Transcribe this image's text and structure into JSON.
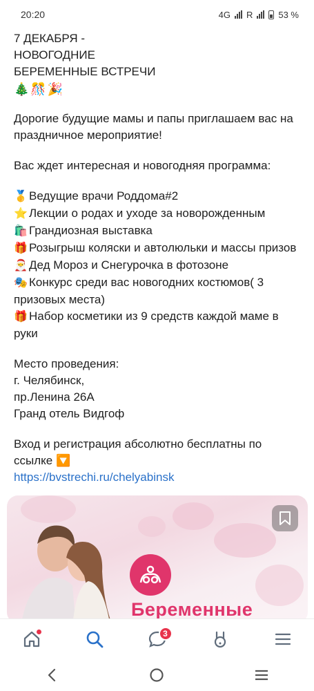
{
  "status_bar": {
    "time": "20:20",
    "network": "4G",
    "roaming": "R",
    "battery": "53 %"
  },
  "post": {
    "title_line1": "7 ДЕКАБРЯ -",
    "title_line2": "НОВОГОДНИЕ",
    "title_line3": "БЕРЕМЕННЫЕ ВСТРЕЧИ",
    "title_emojis": "🎄🎊🎉",
    "intro": "Дорогие будущие мамы и папы приглашаем вас на праздничное мероприятие!",
    "program_intro": "Вас ждет интересная и новогодняя программа:",
    "list": [
      {
        "emoji": "🥇",
        "text": "Ведущие врачи Роддома#2"
      },
      {
        "emoji": "⭐",
        "text": "Лекции о родах и уходе за новорожденным"
      },
      {
        "emoji": "🛍️",
        "text": "Грандиозная выставка"
      },
      {
        "emoji": "🎁",
        "text": "Розыгрыш коляски и автолюльки и массы призов"
      },
      {
        "emoji": "🎅",
        "text": "Дед Мороз и Снегурочка в фотозоне"
      },
      {
        "emoji": "🎭",
        "text": "Конкурс среди вас новогодних костюмов( 3 призовых места)"
      },
      {
        "emoji": "🎁",
        "text": "Набор косметики из 9 средств каждой маме в руки"
      }
    ],
    "venue_label": "Место проведения:",
    "venue_city": "г. Челябинск,",
    "venue_street": "пр.Ленина 26А",
    "venue_hotel": "Гранд отель Видгоф",
    "registration": "Вход и регистрация абсолютно бесплатны по ссылке 🔽",
    "link": "https://bvstrechi.ru/chelyabinsk"
  },
  "card": {
    "title": "Беременные"
  },
  "tab_bar": {
    "messages_badge": "3"
  },
  "colors": {
    "accent": "#2a71c9",
    "brand_pink": "#e0356b",
    "badge_red": "#e8334b"
  },
  "icons": [
    "home-icon",
    "search-icon",
    "messages-icon",
    "services-icon",
    "menu-icon",
    "back-icon",
    "home-nav-icon",
    "recents-icon",
    "bookmark-icon"
  ]
}
